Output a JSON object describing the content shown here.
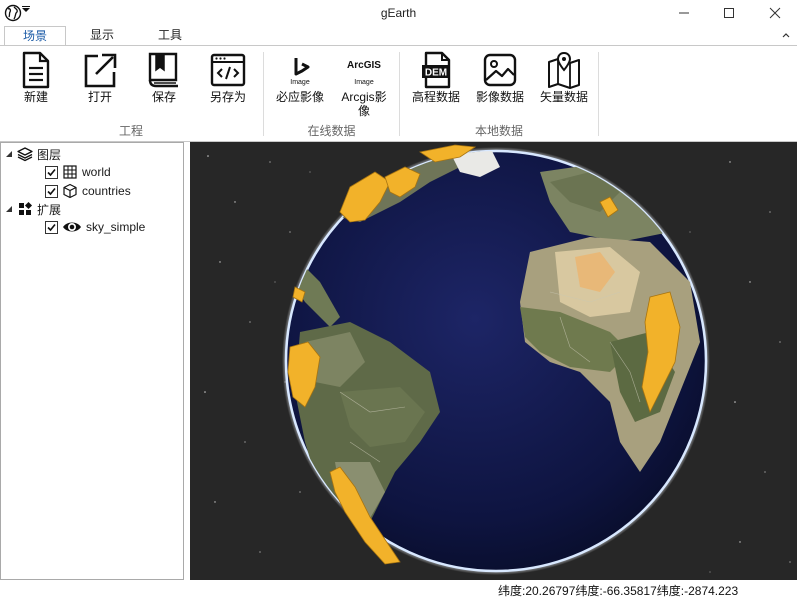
{
  "window": {
    "title": "gEarth",
    "icon": "globe-icon",
    "controls": [
      "minimize-icon",
      "maximize-icon",
      "close-icon"
    ]
  },
  "ribbon": {
    "tabs": [
      {
        "label": "场景",
        "active": true
      },
      {
        "label": "显示",
        "active": false
      },
      {
        "label": "工具",
        "active": false
      }
    ],
    "groups": {
      "project": {
        "label": "工程",
        "buttons": [
          {
            "label": "新建",
            "icon": "new-document-icon"
          },
          {
            "label": "打开",
            "icon": "open-external-icon"
          },
          {
            "label": "保存",
            "icon": "save-book-icon"
          },
          {
            "label": "另存为",
            "icon": "code-window-icon"
          }
        ]
      },
      "online": {
        "label": "在线数据",
        "buttons": [
          {
            "label": "必应影像",
            "icon": "bing-logo-icon",
            "icon_text": "Image"
          },
          {
            "label_line1": "Arcgis影",
            "label_line2": "像",
            "icon": "arcgis-logo-icon",
            "icon_text_top": "ArcGIS",
            "icon_text": "Image"
          }
        ]
      },
      "local": {
        "label": "本地数据",
        "buttons": [
          {
            "label": "高程数据",
            "icon": "dem-file-icon",
            "icon_text": "DEM"
          },
          {
            "label": "影像数据",
            "icon": "image-picture-icon"
          },
          {
            "label": "矢量数据",
            "icon": "map-pin-icon"
          }
        ]
      }
    }
  },
  "tree": {
    "layers_label": "图层",
    "layers": [
      {
        "label": "world",
        "checked": true,
        "icon": "grid-table-icon"
      },
      {
        "label": "countries",
        "checked": true,
        "icon": "cube-icon"
      }
    ],
    "extensions_label": "扩展",
    "extensions": [
      {
        "label": "sky_simple",
        "checked": true,
        "icon": "eye-icon"
      }
    ]
  },
  "status": {
    "text": "纬度:20.26797纬度:-66.35817纬度:-2874.223"
  }
}
